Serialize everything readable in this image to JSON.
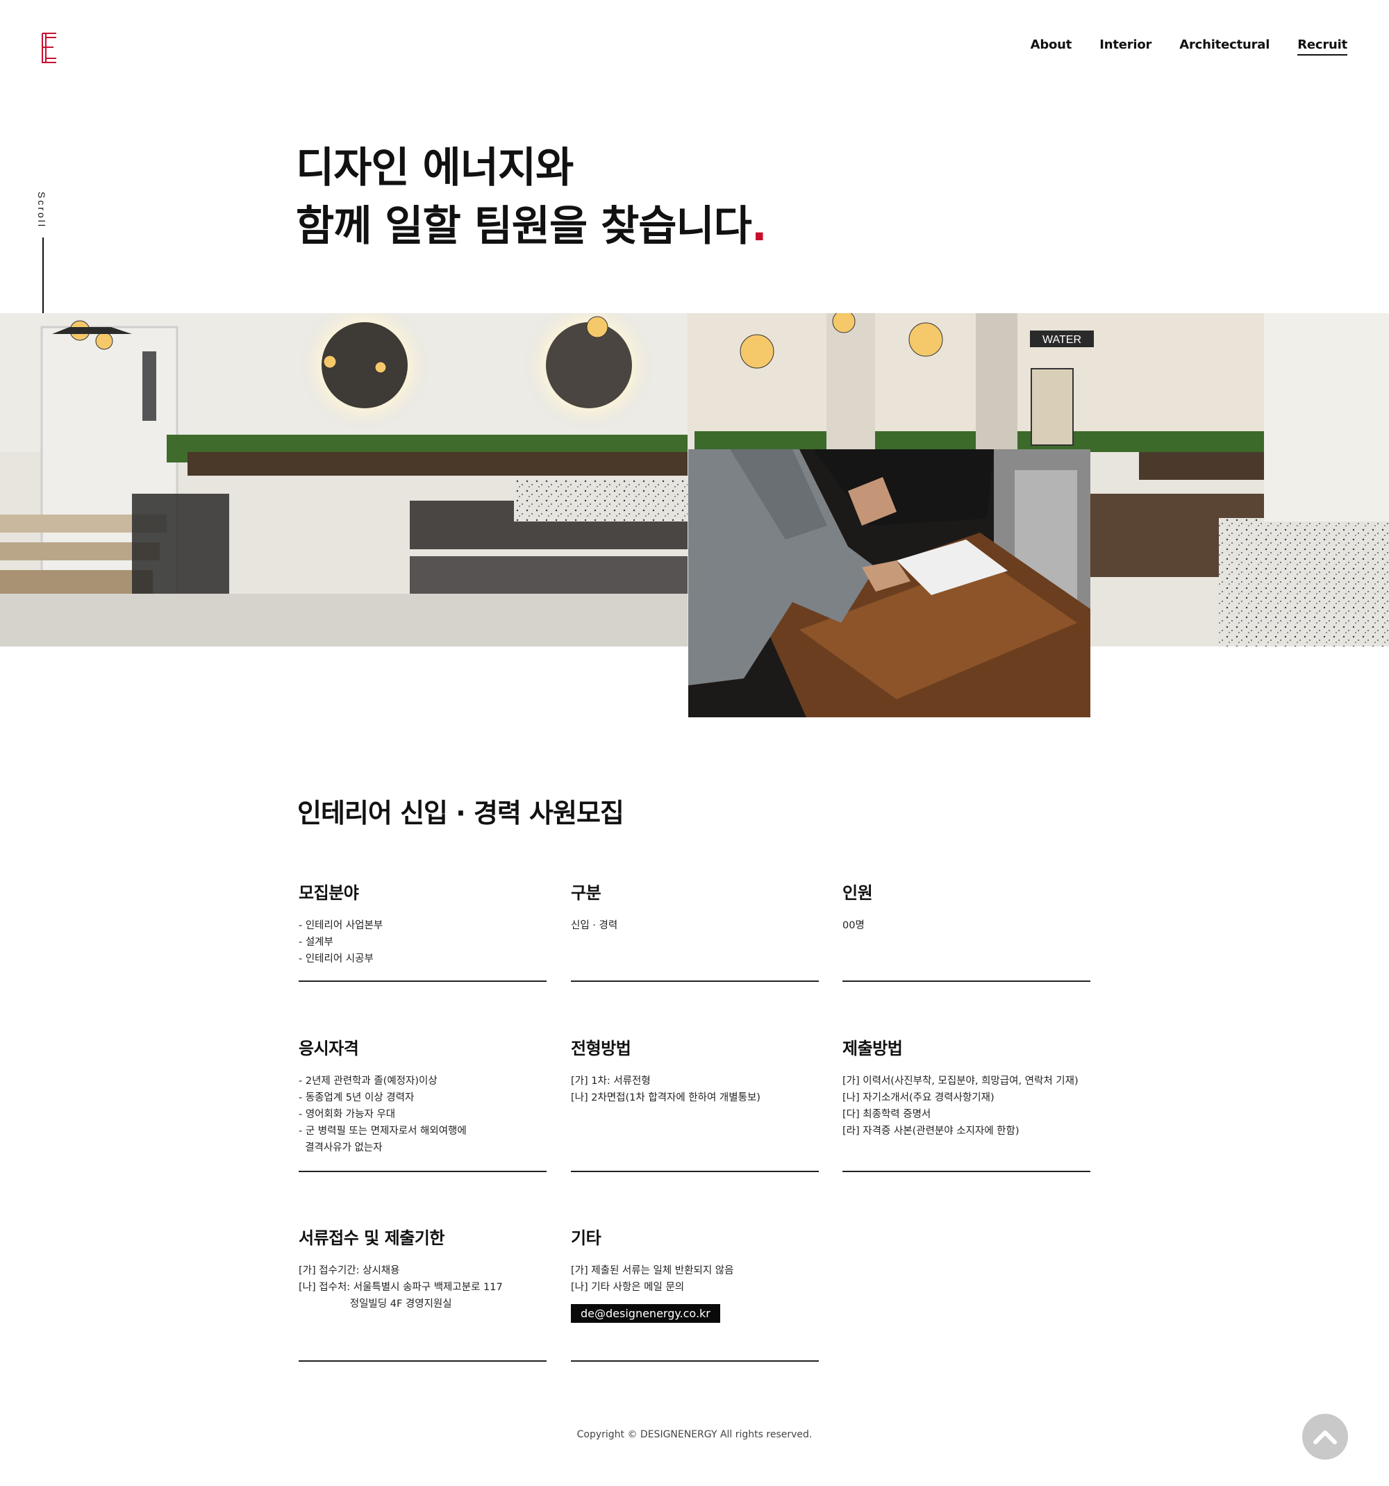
{
  "brand": {
    "logo_letter": "E",
    "accent": "#c8102e"
  },
  "nav": {
    "items": [
      {
        "label": "About",
        "active": false
      },
      {
        "label": "Interior",
        "active": false
      },
      {
        "label": "Architectural",
        "active": false
      },
      {
        "label": "Recruit",
        "active": true
      }
    ]
  },
  "scroll_indicator": {
    "label": "Scroll"
  },
  "hero": {
    "line1": "디자인 에너지와",
    "line2": "함께 일할 팀원을 찾습니다",
    "dot": "."
  },
  "photos": {
    "sign_text": "WATER"
  },
  "recruit": {
    "title": "인테리어 신입 · 경력 사원모집",
    "blocks": [
      {
        "title": "모집분야",
        "lines": [
          "- 인테리어 사업본부",
          "- 설계부",
          "- 인테리어 시공부"
        ]
      },
      {
        "title": "구분",
        "lines": [
          "신입 · 경력"
        ]
      },
      {
        "title": "인원",
        "lines": [
          "00명"
        ]
      },
      {
        "title": "응시자격",
        "lines": [
          "- 2년제 관련학과 졸(예정자)이상",
          "- 동종업계 5년 이상 경력자",
          "- 영어회화 가능자 우대",
          "- 군 병력필 또는 면제자로서 해외여행에",
          "  결격사유가 없는자"
        ]
      },
      {
        "title": "전형방법",
        "lines": [
          "[가] 1차: 서류전형",
          "[나] 2차면접(1차 합격자에 한하여 개별통보)"
        ]
      },
      {
        "title": "제출방법",
        "lines": [
          "[가] 이력서(사진부착, 모집분야, 희망급여, 연락처 기재)",
          "[나] 자기소개서(주요 경력사항기재)",
          "[다] 최종학력 증명서",
          "[라] 자격증 사본(관련분야 소지자에 한함)"
        ]
      },
      {
        "title": "서류접수 및 제출기한",
        "lines": [
          "[가] 접수기간: 상시채용",
          "[나] 접수처: 서울특별시 송파구 백제고분로 117",
          "                정일빌딩 4F 경영지원실"
        ]
      },
      {
        "title": "기타",
        "lines": [
          "[가] 제출된 서류는 일체 반환되지 않음",
          "[나] 기타 사항은 메일 문의"
        ],
        "email": "de@designenergy.co.kr"
      }
    ]
  },
  "footer": {
    "copyright": "Copyright © DESIGNENERGY All rights reserved."
  }
}
